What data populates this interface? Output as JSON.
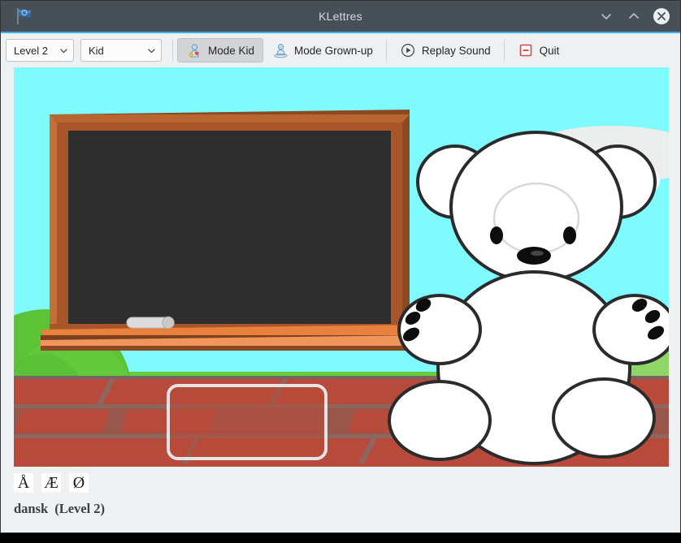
{
  "window": {
    "title": "KLettres",
    "app_icon": "flag-icon",
    "titlebar_color": "#475057",
    "accent_color": "#3daee9",
    "buttons": [
      {
        "name": "minimize-button",
        "icon": "chevron-down-icon"
      },
      {
        "name": "maximize-button",
        "icon": "chevron-up-icon"
      },
      {
        "name": "close-button",
        "icon": "close-circle-icon"
      }
    ]
  },
  "toolbar": {
    "level_select": {
      "value": "Level 2",
      "icon": "chevron-down-icon"
    },
    "language_select": {
      "value": "Kid",
      "icon": "chevron-down-icon"
    },
    "mode_kid": {
      "label": "Mode Kid",
      "icon": "kid-person-icon",
      "active": true
    },
    "mode_grownup": {
      "label": "Mode Grown-up",
      "icon": "grownup-person-icon",
      "active": false
    },
    "replay_sound": {
      "label": "Replay Sound",
      "icon": "play-circle-icon"
    },
    "quit": {
      "label": "Quit",
      "icon": "quit-minus-icon"
    }
  },
  "scene": {
    "sky_color": "#7ffbff",
    "grass_color": "#5cc236",
    "brick_color": "#b84a3b",
    "blackboard_color": "#2e2e2e",
    "frame_color": "#a8552a",
    "ledge_color": "#e8803e",
    "bear_color": "#ffffff",
    "answer_input": {
      "value": "",
      "placeholder": ""
    },
    "letter_on_board": ""
  },
  "special_characters": [
    {
      "char": "Å",
      "name": "special-char-a-ring"
    },
    {
      "char": "Æ",
      "name": "special-char-ae"
    },
    {
      "char": "Ø",
      "name": "special-char-o-slash"
    }
  ],
  "status": {
    "language": "dansk",
    "level": "(Level 2)"
  }
}
